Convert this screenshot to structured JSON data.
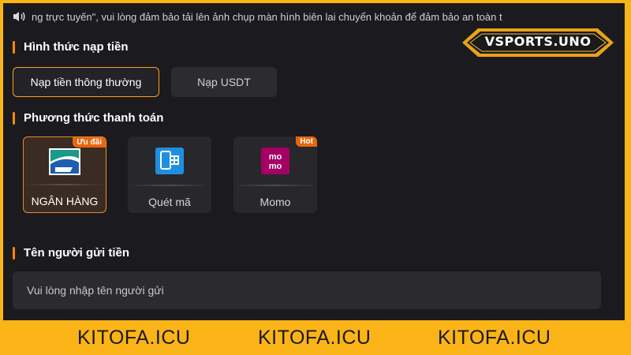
{
  "marquee": {
    "text": "ng trực tuyến\", vui lòng đảm bảo tải lên ảnh chụp màn hình biên lai chuyển khoản để đảm bảo an toàn t"
  },
  "logo": {
    "text": "VSPORTS.UNO"
  },
  "deposit_form": {
    "title": "Hình thức nạp tiền",
    "tabs": [
      {
        "label": "Nạp tiền thông thường",
        "active": true
      },
      {
        "label": "Nạp USDT",
        "active": false
      }
    ]
  },
  "payment": {
    "title": "Phương thức thanh toán",
    "methods": [
      {
        "label": "NGÂN HÀNG",
        "badge": "Ưu đãi",
        "icon": "bank-icon",
        "active": true
      },
      {
        "label": "Quét mã",
        "badge": "",
        "icon": "qr-scan-icon",
        "active": false
      },
      {
        "label": "Momo",
        "badge": "Hot",
        "icon": "momo-icon",
        "icon_text": "mo mo",
        "active": false
      }
    ]
  },
  "sender": {
    "title": "Tên người gửi tiền",
    "placeholder": "Vui lòng nhập tên người gửi"
  },
  "watermark": {
    "text": "KITOFA.ICU"
  },
  "colors": {
    "accent": "#ff9f1a",
    "frame": "#fbb417",
    "panel": "#1b1b1f",
    "badge": "#e8660d"
  }
}
